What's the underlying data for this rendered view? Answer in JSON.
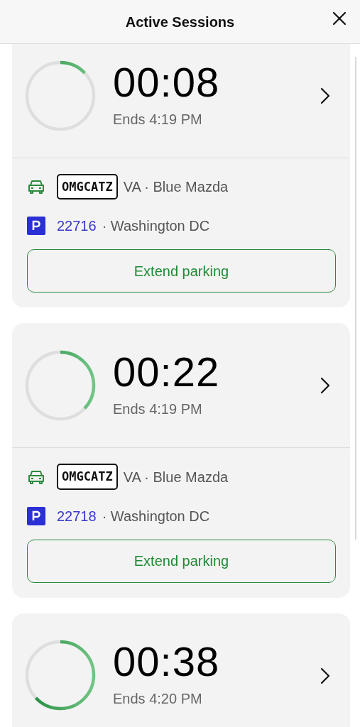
{
  "header": {
    "title": "Active Sessions"
  },
  "sessions": [
    {
      "timer": "00:08",
      "ends": "Ends 4:19 PM",
      "level": 0.13,
      "plate": "OMGCATZ",
      "vehicle": "VA · Blue Mazda",
      "zone": "22716",
      "location": "· Washington DC",
      "button": "Extend parking"
    },
    {
      "timer": "00:22",
      "ends": "Ends 4:19 PM",
      "level": 0.37,
      "plate": "OMGCATZ",
      "vehicle": "VA · Blue Mazda",
      "zone": "22718",
      "location": "· Washington DC",
      "button": "Extend parking"
    },
    {
      "timer": "00:38",
      "ends": "Ends 4:20 PM",
      "level": 0.63
    }
  ]
}
